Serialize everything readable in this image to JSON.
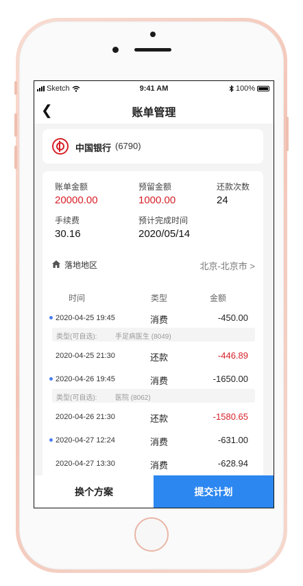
{
  "status_bar": {
    "carrier": "Sketch",
    "time": "9:41 AM",
    "battery": "100%"
  },
  "nav": {
    "title": "账单管理"
  },
  "bank": {
    "name": "中国银行",
    "tail": "(6790)"
  },
  "details": {
    "bill_amount": {
      "label": "账单金额",
      "value": "20000.00"
    },
    "reserved_amount": {
      "label": "预留金额",
      "value": "1000.00"
    },
    "repay_times": {
      "label": "还款次数",
      "value": "24"
    },
    "fee": {
      "label": "手续费",
      "value": "30.16"
    },
    "finish_time": {
      "label": "预计完成时间",
      "value": "2020/05/14"
    }
  },
  "region": {
    "label": "落地地区",
    "value": "北京-北京市 >"
  },
  "table": {
    "headers": {
      "time": "时间",
      "type": "类型",
      "amount": "金额"
    },
    "rows": [
      {
        "date": "2020-04-25  19:45",
        "type": "消费",
        "amount": "-450.00",
        "tag_key": "类型(可自选):",
        "tag_value": "手足病医生  (8049)"
      },
      {
        "date": "2020-04-25  21:30",
        "type": "还款",
        "amount": "-446.89"
      },
      {
        "date": "2020-04-26  19:45",
        "type": "消费",
        "amount": "-1650.00",
        "tag_key": "类型(可自选):",
        "tag_value": "医院  (8062)"
      },
      {
        "date": "2020-04-26  21:30",
        "type": "还款",
        "amount": "-1580.65"
      },
      {
        "date": "2020-04-27  12:24",
        "type": "消费",
        "amount": "-631.00"
      },
      {
        "date": "2020-04-27  13:30",
        "type": "消费",
        "amount": "-628.94"
      }
    ]
  },
  "actions": {
    "change_plan": "换个方案",
    "submit_plan": "提交计划"
  },
  "colors": {
    "accent": "#2d87f0",
    "negative": "#d51f27",
    "consume_dot": "#4a7df0"
  }
}
